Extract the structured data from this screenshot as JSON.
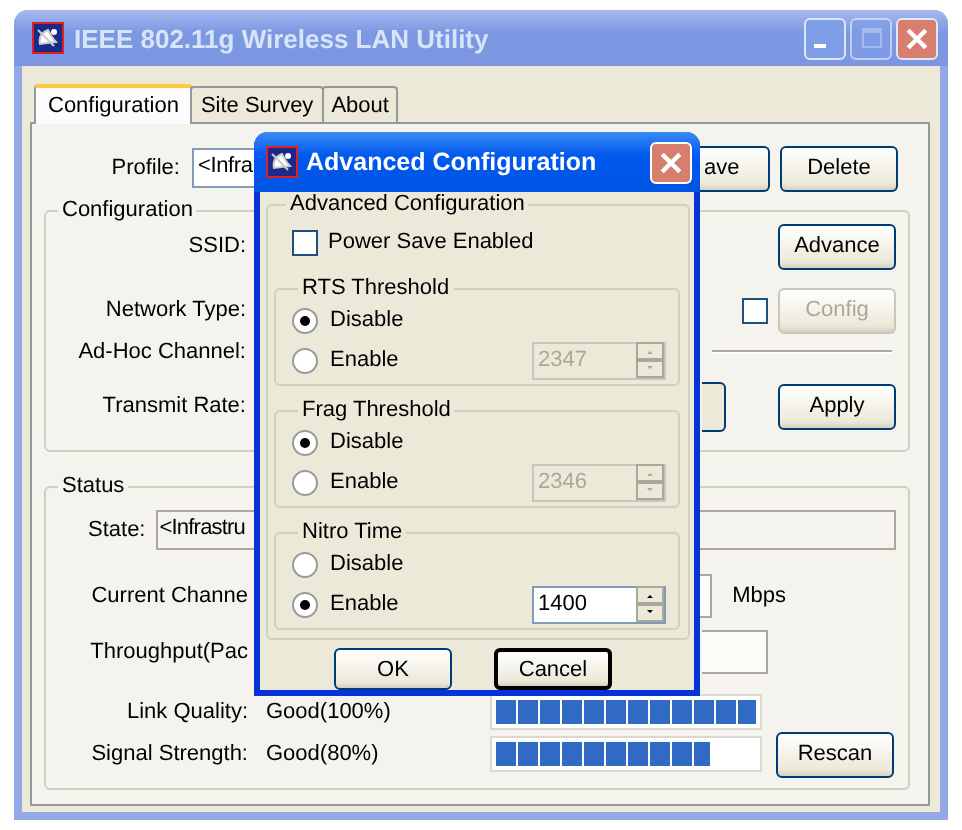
{
  "window": {
    "title": "IEEE 802.11g Wireless LAN Utility",
    "active": false
  },
  "tabs": [
    {
      "label": "Configuration",
      "selected": true
    },
    {
      "label": "Site Survey",
      "selected": false
    },
    {
      "label": "About",
      "selected": false
    }
  ],
  "profile": {
    "label": "Profile:",
    "value": "<Infra",
    "buttons": [
      "ave",
      "Delete"
    ]
  },
  "configuration": {
    "title": "Configuration",
    "labels": [
      "SSID:",
      "Network Type:",
      "Ad-Hoc Channel:",
      "Transmit Rate:"
    ],
    "advance_button": "Advance",
    "config_checkbox": {
      "checked": false
    },
    "config_button": {
      "label": "Config",
      "disabled": true
    },
    "apply_button": "Apply"
  },
  "status": {
    "title": "Status",
    "state": {
      "label": "State:",
      "value": "<Infrastru"
    },
    "current_channel": {
      "label": "Current Channe",
      "unit": "Mbps"
    },
    "throughput": {
      "label": "Throughput(Pac"
    },
    "link_quality": {
      "label": "Link Quality:",
      "value": "Good(100%)",
      "level": 1
    },
    "signal_strength": {
      "label": "Signal Strength:",
      "value": "Good(80%)",
      "level": 0.82
    },
    "rescan_button": "Rescan"
  },
  "dialog": {
    "title": "Advanced Configuration",
    "group_title": "Advanced Configuration",
    "power_save": {
      "label": "Power Save Enabled",
      "checked": false
    },
    "sections": [
      {
        "title": "RTS Threshold",
        "options": [
          {
            "label": "Disable",
            "selected": true
          },
          {
            "label": "Enable",
            "selected": false
          }
        ],
        "value": "2347",
        "disabled": true
      },
      {
        "title": "Frag Threshold",
        "options": [
          {
            "label": "Disable",
            "selected": true
          },
          {
            "label": "Enable",
            "selected": false
          }
        ],
        "value": "2346",
        "disabled": true
      },
      {
        "title": "Nitro Time",
        "options": [
          {
            "label": "Disable",
            "selected": false
          },
          {
            "label": "Enable",
            "selected": true
          }
        ],
        "value": "1400",
        "disabled": false
      }
    ],
    "buttons": [
      {
        "label": "OK",
        "focused": false
      },
      {
        "label": "Cancel",
        "focused": true
      }
    ]
  }
}
